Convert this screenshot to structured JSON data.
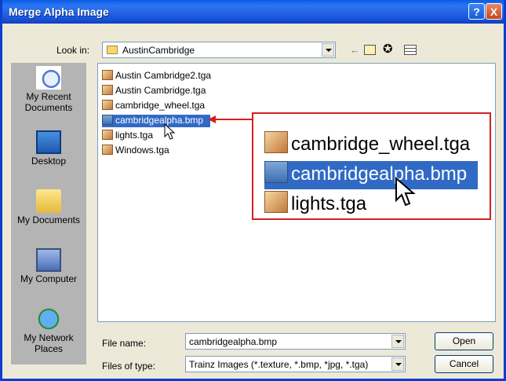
{
  "window": {
    "title": "Merge Alpha Image",
    "help_glyph": "?",
    "close_glyph": "X"
  },
  "toolbar": {
    "look_in_label": "Look in:",
    "look_in_value": "AustinCambridge"
  },
  "places": [
    {
      "label": "My Recent Documents",
      "icon": "recent-documents-icon"
    },
    {
      "label": "Desktop",
      "icon": "desktop-icon"
    },
    {
      "label": "My Documents",
      "icon": "my-documents-icon"
    },
    {
      "label": "My Computer",
      "icon": "my-computer-icon"
    },
    {
      "label": "My Network Places",
      "icon": "network-places-icon"
    }
  ],
  "files": [
    {
      "name": "Austin Cambridge2.tga",
      "type": "tga",
      "selected": false
    },
    {
      "name": "Austin Cambridge.tga",
      "type": "tga",
      "selected": false
    },
    {
      "name": "cambridge_wheel.tga",
      "type": "tga",
      "selected": false
    },
    {
      "name": "cambridgealpha.bmp",
      "type": "bmp",
      "selected": true
    },
    {
      "name": "lights.tga",
      "type": "tga",
      "selected": false
    },
    {
      "name": "Windows.tga",
      "type": "tga",
      "selected": false
    }
  ],
  "zoom_callout": [
    {
      "name": "cambridge_wheel.tga",
      "type": "tga",
      "selected": false
    },
    {
      "name": "cambridgealpha.bmp",
      "type": "bmp",
      "selected": true
    },
    {
      "name": "lights.tga",
      "type": "tga",
      "selected": false
    }
  ],
  "bottom": {
    "file_name_label": "File name:",
    "file_name_value": "cambridgealpha.bmp",
    "file_type_label": "Files of type:",
    "file_type_value": "Trainz Images  (*.texture, *.bmp, *jpg, *.tga)",
    "open_label": "Open",
    "cancel_label": "Cancel"
  },
  "colors": {
    "selection": "#316ac5",
    "callout_border": "#d42020",
    "title_bar": "#0a5ce6"
  }
}
